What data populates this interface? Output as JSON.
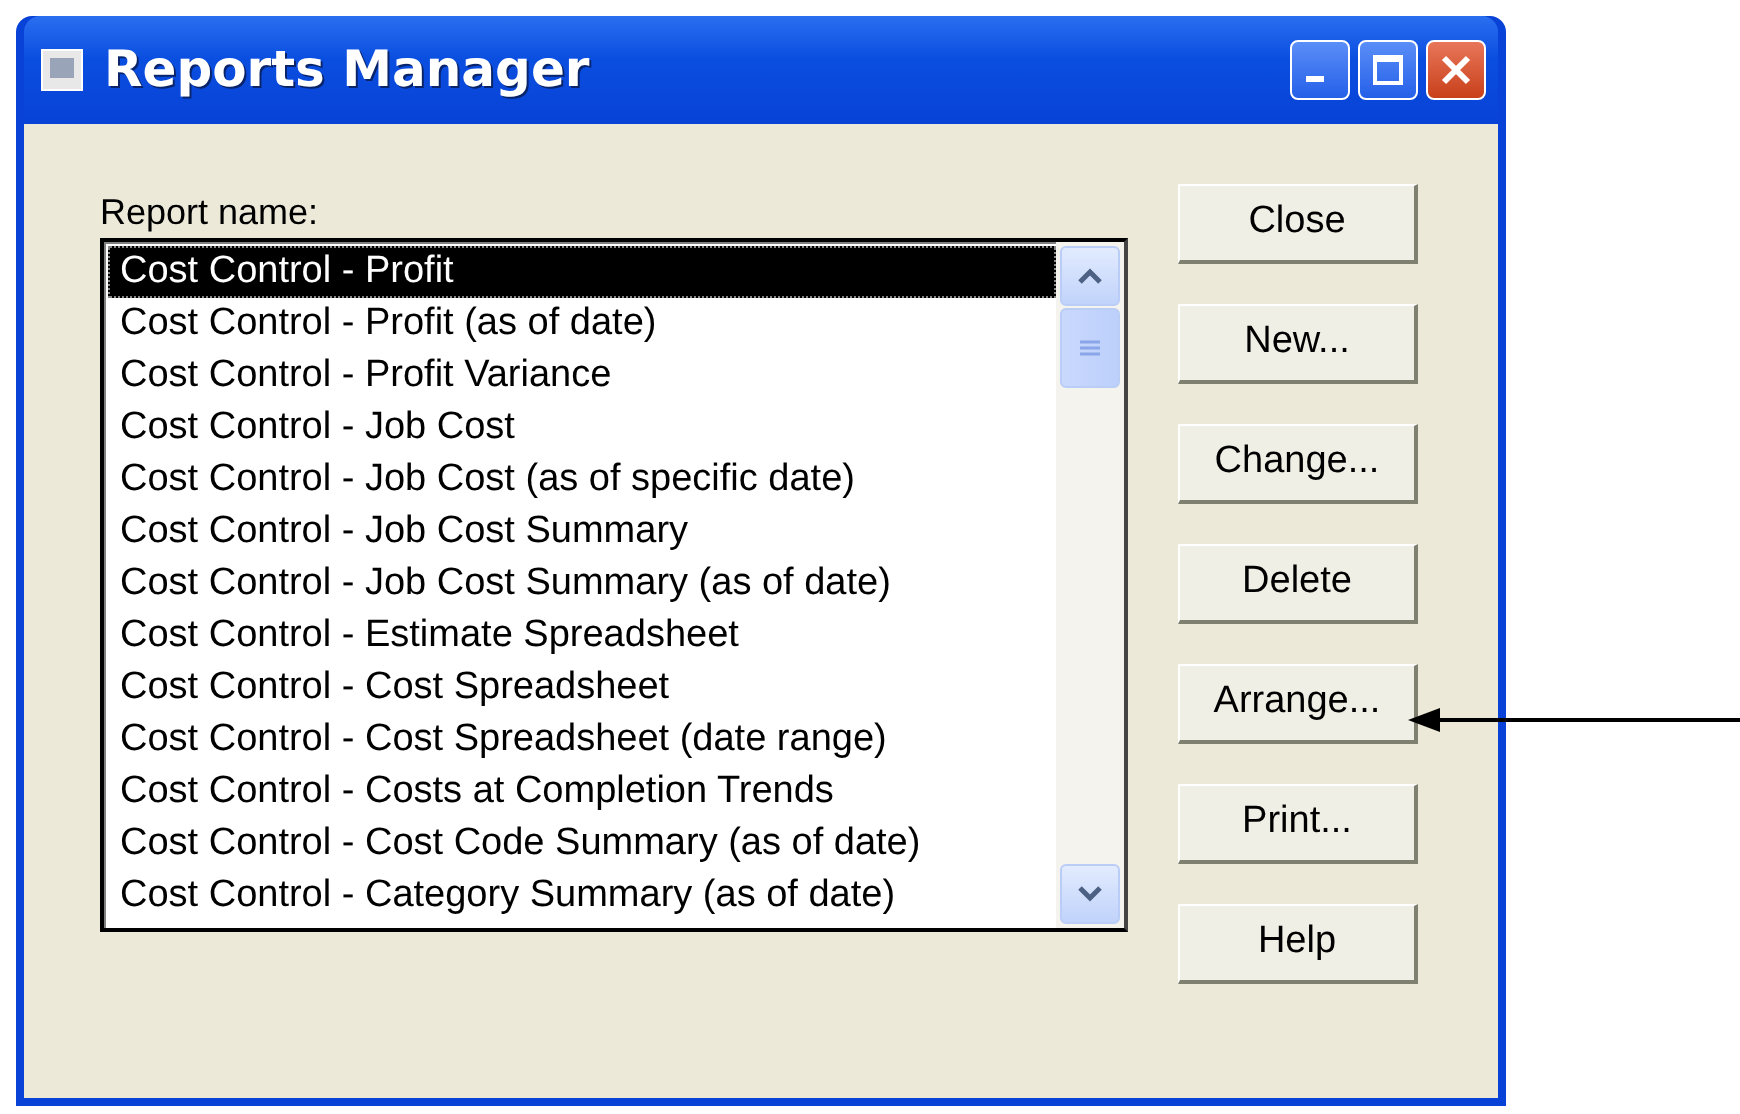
{
  "window": {
    "title": "Reports Manager"
  },
  "list": {
    "label": "Report name:",
    "items": [
      {
        "text": "Cost Control - Profit",
        "selected": true
      },
      {
        "text": "Cost Control - Profit (as of date)",
        "selected": false
      },
      {
        "text": "Cost Control - Profit Variance",
        "selected": false
      },
      {
        "text": "Cost Control - Job Cost",
        "selected": false
      },
      {
        "text": "Cost Control - Job Cost (as of specific date)",
        "selected": false
      },
      {
        "text": "Cost Control - Job Cost Summary",
        "selected": false
      },
      {
        "text": "Cost Control - Job Cost Summary (as of date)",
        "selected": false
      },
      {
        "text": "Cost Control - Estimate Spreadsheet",
        "selected": false
      },
      {
        "text": "Cost Control - Cost Spreadsheet",
        "selected": false
      },
      {
        "text": "Cost Control - Cost Spreadsheet (date range)",
        "selected": false
      },
      {
        "text": "Cost Control - Costs at Completion Trends",
        "selected": false
      },
      {
        "text": "Cost Control - Cost Code Summary (as of date)",
        "selected": false
      },
      {
        "text": "Cost Control - Category Summary (as of date)",
        "selected": false
      }
    ]
  },
  "buttons": [
    {
      "label": "Close"
    },
    {
      "label": "New..."
    },
    {
      "label": "Change..."
    },
    {
      "label": "Delete"
    },
    {
      "label": "Arrange...",
      "pointed_at": true
    },
    {
      "label": "Print..."
    },
    {
      "label": "Help"
    }
  ]
}
